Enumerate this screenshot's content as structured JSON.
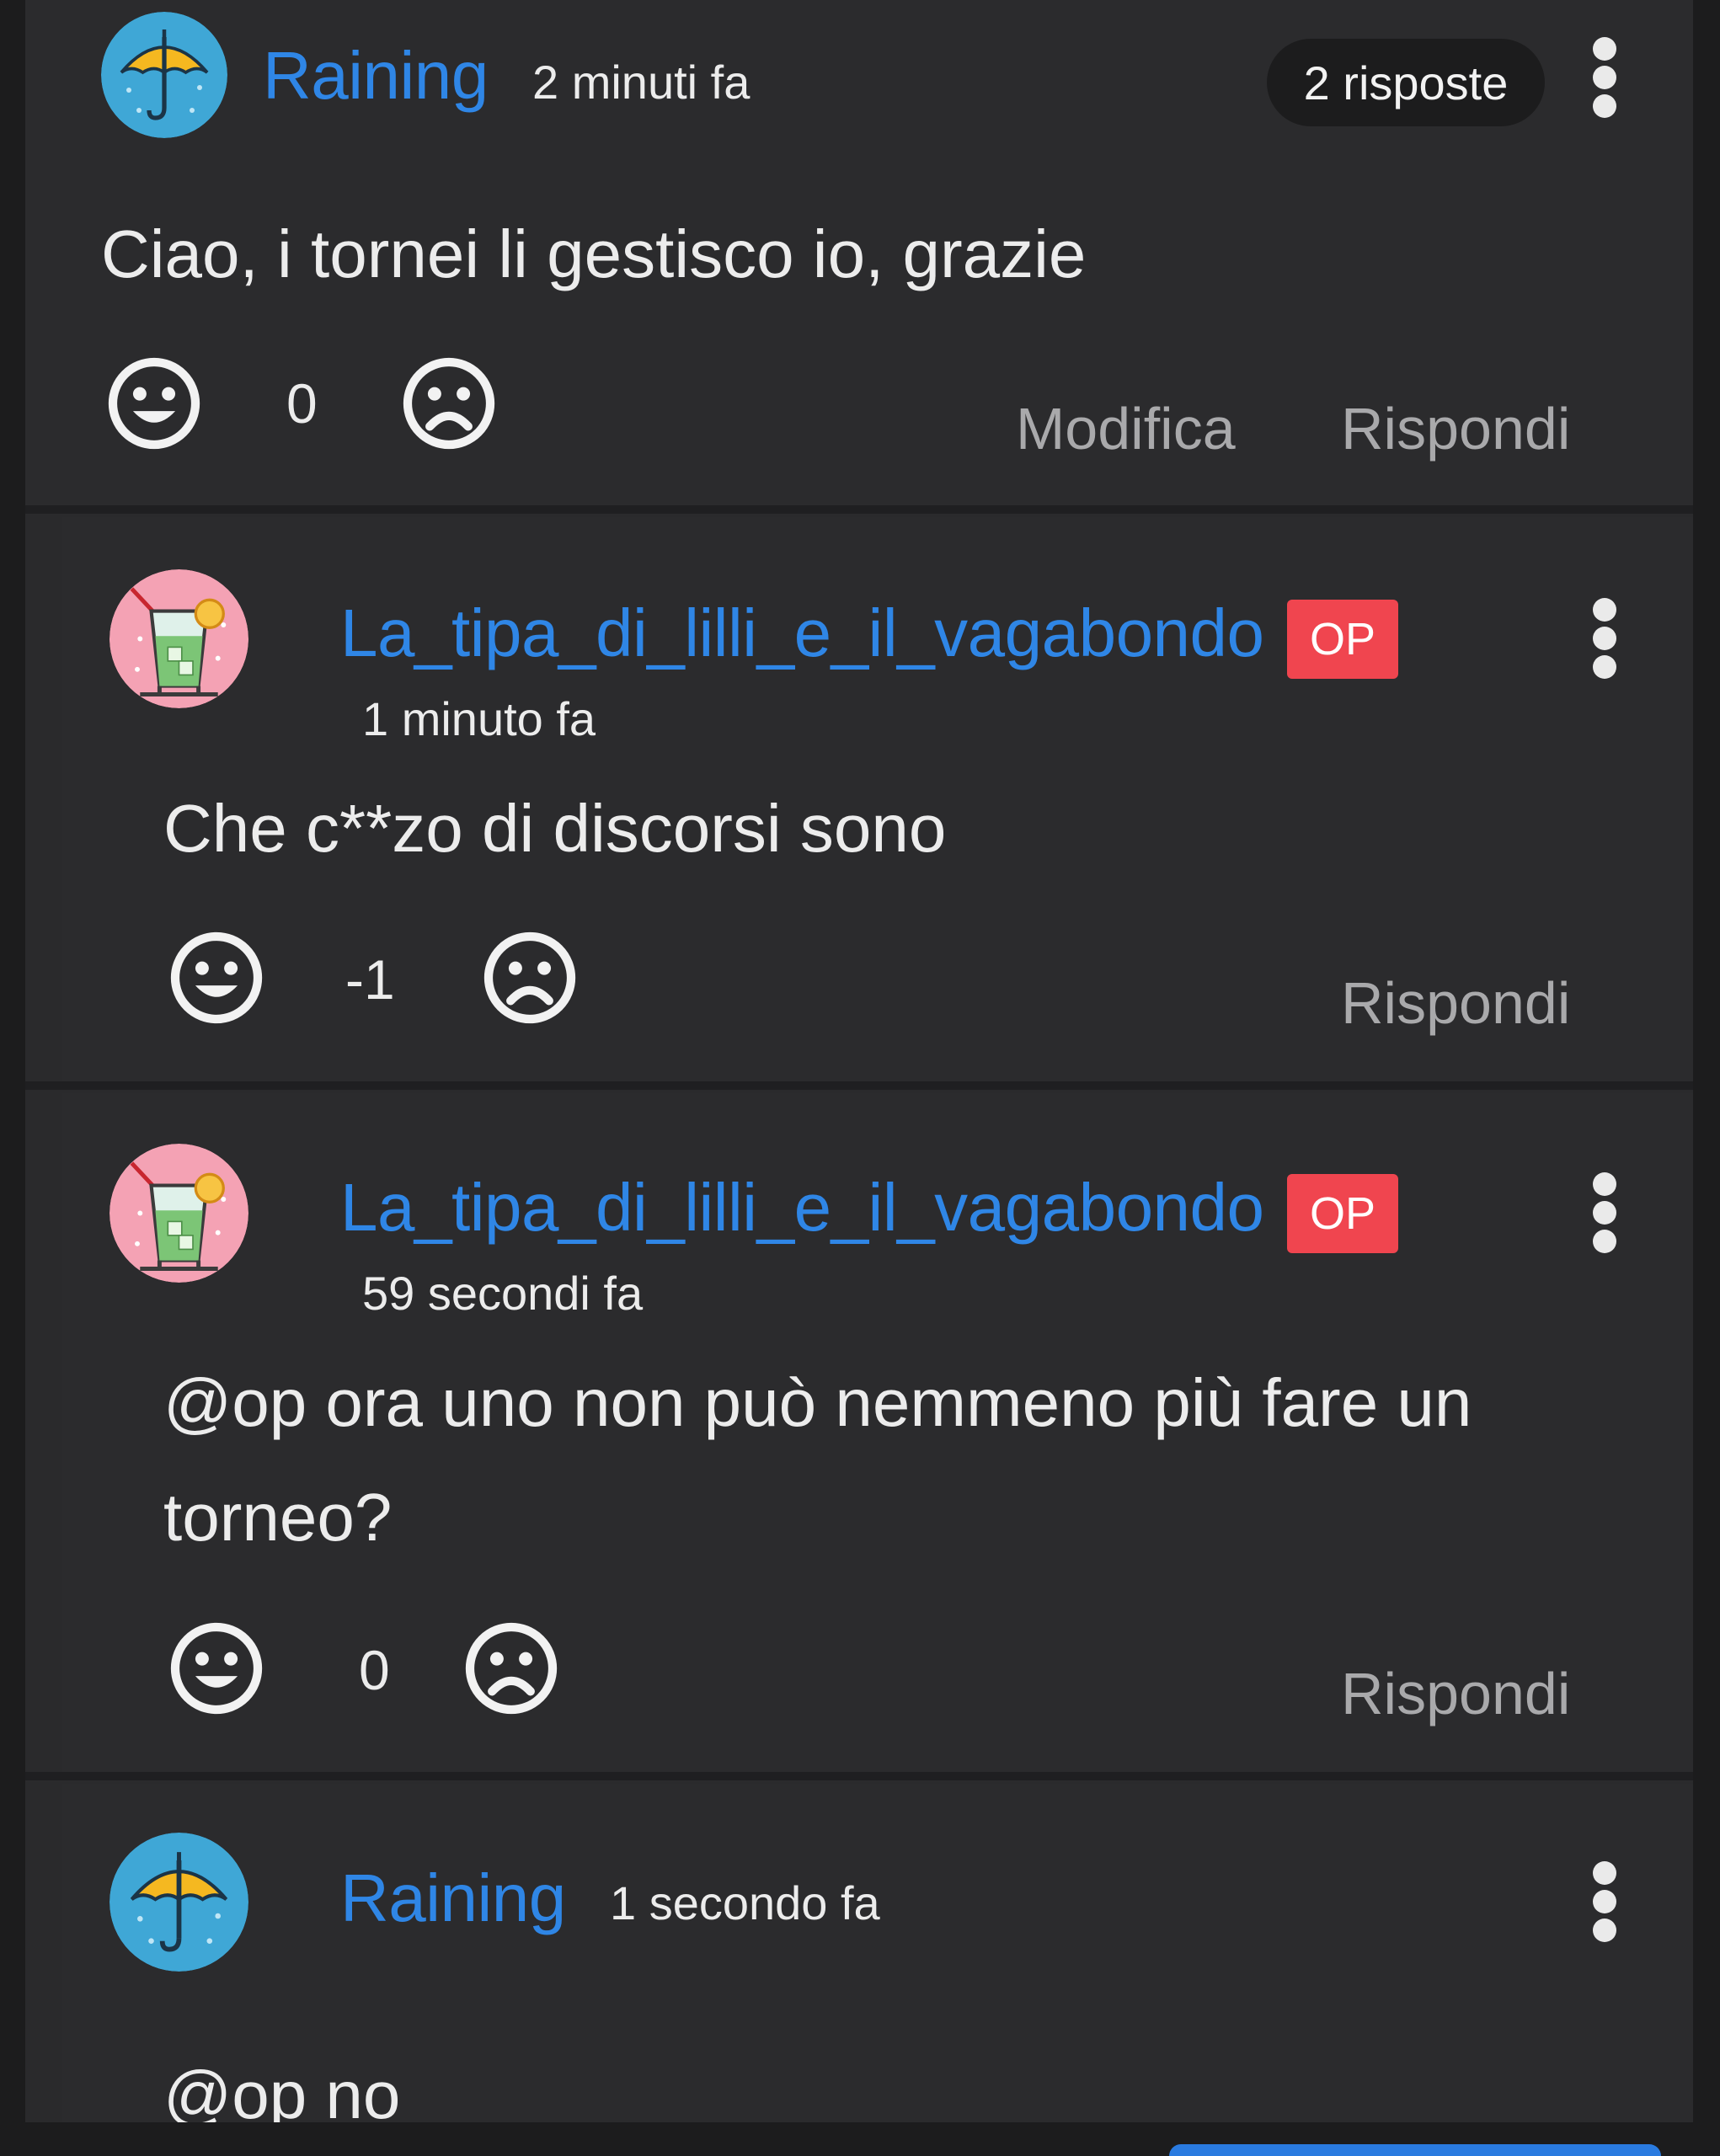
{
  "top_comment": {
    "username": "Raining",
    "time": "2 minuti fa",
    "replies_label": "2 risposte",
    "text": "Ciao, i tornei li gestisco io, grazie",
    "score": "0",
    "edit_label": "Modifica",
    "reply_label": "Rispondi",
    "avatar_icon": "umbrella-icon"
  },
  "replies": [
    {
      "username": "La_tipa_di_lilli_e_il_vagabondo",
      "badge": "OP",
      "time": "1 minuto fa",
      "text_lines": [
        "Che c**zo di discorsi sono"
      ],
      "score": "-1",
      "reply_label": "Rispondi",
      "avatar_icon": "cocktail-icon"
    },
    {
      "username": "La_tipa_di_lilli_e_il_vagabondo",
      "badge": "OP",
      "time": "59 secondi fa",
      "text_lines": [
        "@op ora uno non può nemmeno più fare un",
        "torneo?"
      ],
      "score": "0",
      "reply_label": "Rispondi",
      "avatar_icon": "cocktail-icon"
    },
    {
      "username": "Raining",
      "time": "1 secondo fa",
      "text_lines": [
        "@op no"
      ],
      "avatar_icon": "umbrella-icon"
    }
  ],
  "colors": {
    "background": "#2b2b2d",
    "username": "#2f86e6",
    "op_badge": "#f0454f",
    "action_text": "#a9a9ab",
    "accent_bar": "#2a7be0"
  }
}
